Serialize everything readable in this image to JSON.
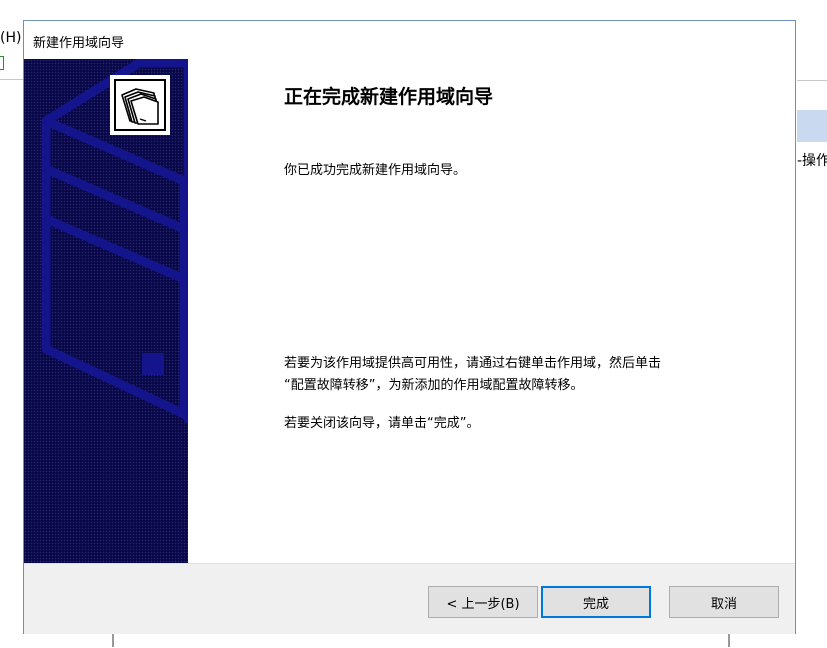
{
  "background": {
    "menu_fragment": "(H)",
    "right_panel_text": "-操作"
  },
  "dialog": {
    "title": "新建作用域向导",
    "heading": "正在完成新建作用域向导",
    "paragraph1": "你已成功完成新建作用域向导。",
    "paragraph2_line1": "若要为该作用域提供高可用性，请通过右键单击作用域，然后单击",
    "paragraph2_line2": "“配置故障转移”，为新添加的作用域配置故障转移。",
    "paragraph3": "若要关闭该向导，请单击“完成”。",
    "logo_icon": "folders-icon",
    "sidebar_color": "#080848",
    "accent_color": "#0078d7"
  },
  "buttons": {
    "back": "< 上一步(B)",
    "finish": "完成",
    "cancel": "取消"
  }
}
